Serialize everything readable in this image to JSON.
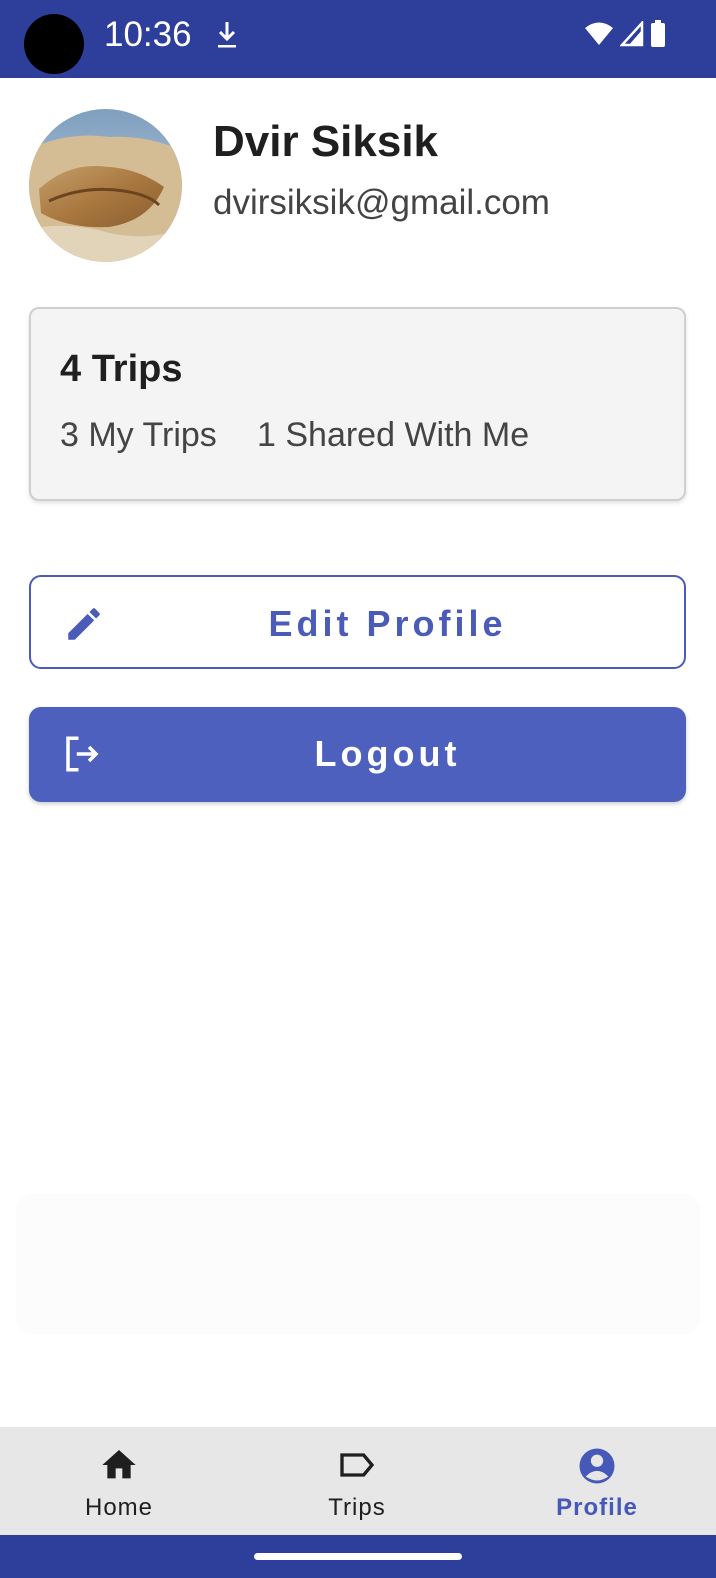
{
  "status_bar": {
    "time": "10:36",
    "icons": [
      "download-icon",
      "wifi-icon",
      "signal-icon",
      "battery-icon"
    ]
  },
  "profile": {
    "name": "Dvir Siksik",
    "email": "dvirsiksik@gmail.com"
  },
  "trips_summary": {
    "total_label": "4 Trips",
    "my_trips_label": "3 My Trips",
    "shared_label": "1 Shared With Me"
  },
  "actions": {
    "edit_label": "Edit Profile",
    "logout_label": "Logout"
  },
  "bottom_nav": {
    "items": [
      {
        "label": "Home",
        "icon": "home-icon",
        "active": false
      },
      {
        "label": "Trips",
        "icon": "tag-icon",
        "active": false
      },
      {
        "label": "Profile",
        "icon": "account-circle-icon",
        "active": true
      }
    ]
  },
  "colors": {
    "primary": "#2e3f9b",
    "accent": "#4d60bd",
    "nav_background": "#e7e7e7"
  }
}
